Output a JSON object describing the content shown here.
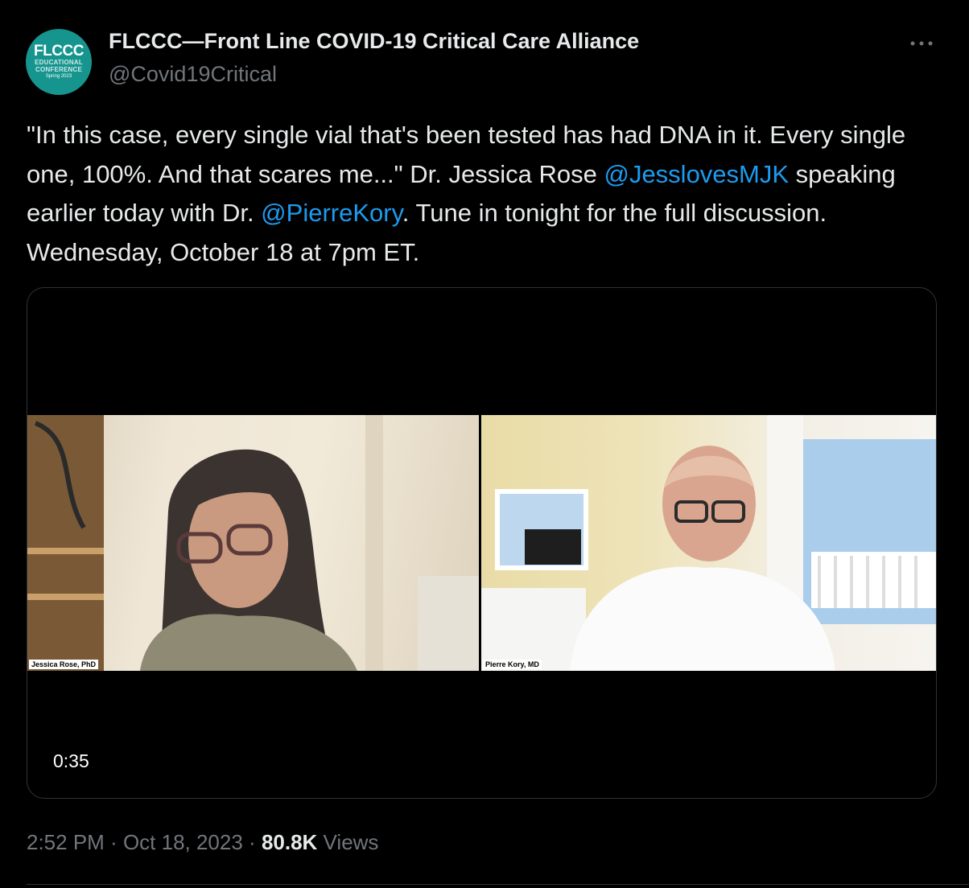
{
  "author": {
    "avatar": {
      "logo_text": "FLCCC",
      "line1": "EDUCATIONAL",
      "line2": "CONFERENCE",
      "line3": "Spring 2023"
    },
    "display_name": "FLCCC—Front Line COVID-19 Critical Care Alliance",
    "handle": "@Covid19Critical"
  },
  "more_menu_icon": "more-horizontal-icon",
  "tweet": {
    "text_part1": "\"In this case, every single vial that's been tested has had DNA in it. Every single one, 100%. And that scares me...\" Dr. Jessica Rose ",
    "mention1": "@JesslovesMJK",
    "text_part2": " speaking earlier today with Dr. ",
    "mention2": "@PierreKory",
    "text_part3": ". Tune in tonight for the full discussion. Wednesday, October 18 at 7pm ET."
  },
  "video": {
    "left_participant": "Jessica Rose, PhD",
    "right_participant": "Pierre Kory, MD",
    "timecode": "0:35"
  },
  "meta": {
    "time": "2:52 PM",
    "separator1": " · ",
    "date": "Oct 18, 2023",
    "separator2": " · ",
    "views_count": "80.8K",
    "views_label": " Views"
  },
  "colors": {
    "background": "#000000",
    "text": "#e7e9ea",
    "secondary": "#71767b",
    "link": "#1d9bf0",
    "avatar_bg": "#16958f"
  }
}
